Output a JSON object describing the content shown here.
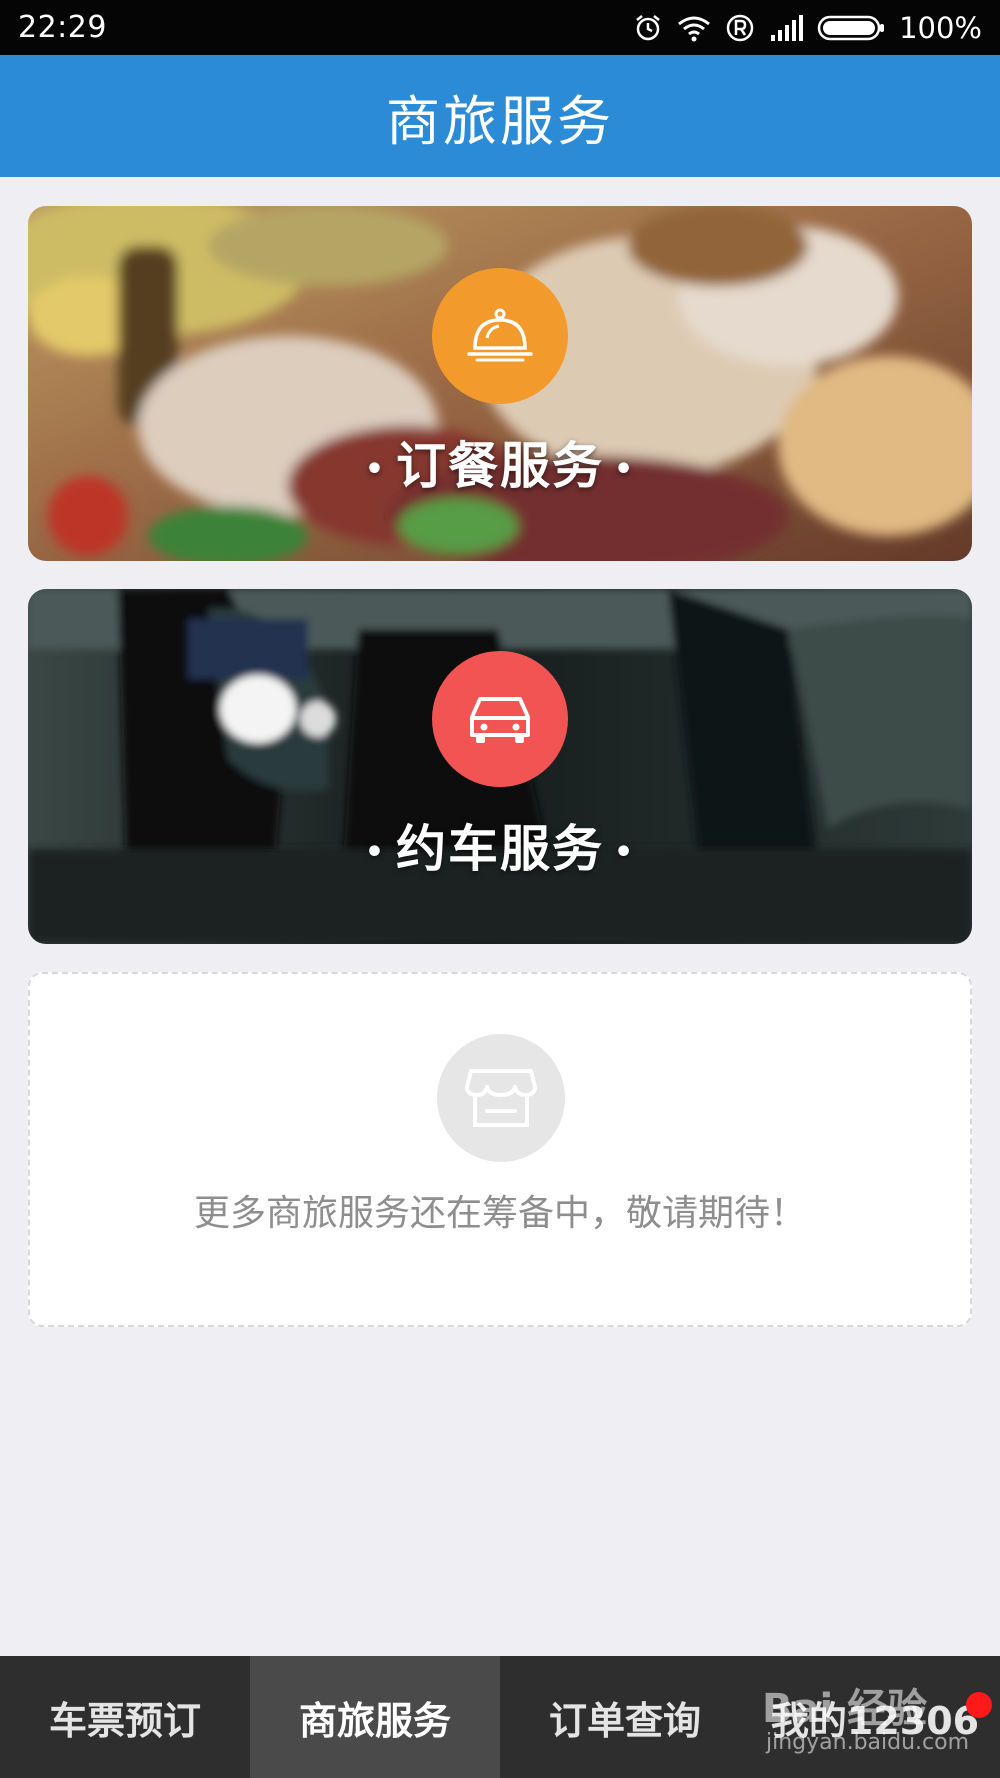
{
  "status_bar": {
    "time": "22:29",
    "battery": "100%",
    "icons": [
      "alarm-icon",
      "wifi-icon",
      "registered-icon",
      "signal-icon",
      "battery-icon"
    ]
  },
  "header": {
    "title": "商旅服务"
  },
  "cards": [
    {
      "label": "订餐服务",
      "icon": "food-cloche-icon",
      "accent": "#f39a2d"
    },
    {
      "label": "约车服务",
      "icon": "car-icon",
      "accent": "#f25454"
    }
  ],
  "placeholder": {
    "icon": "store-icon",
    "text": "更多商旅服务还在筹备中，敬请期待！"
  },
  "bottom_nav": {
    "items": [
      {
        "label": "车票预订"
      },
      {
        "label": "商旅服务",
        "active": true
      },
      {
        "label": "订单查询"
      },
      {
        "label": "我的12306",
        "badge": true
      }
    ]
  },
  "watermark": {
    "brand": "Bai 经验",
    "url": "jingyan.baidu.com"
  },
  "colors": {
    "header": "#2b8bd6",
    "background": "#efeef3",
    "nav": "#2e2e2e"
  }
}
